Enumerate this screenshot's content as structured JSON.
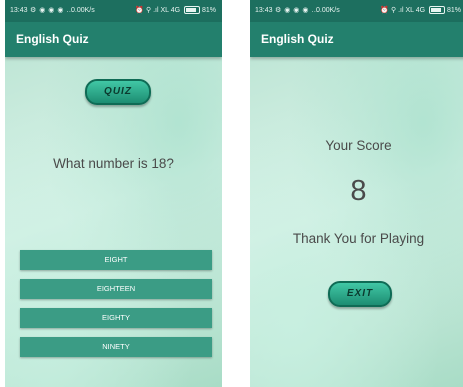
{
  "status_bar": {
    "time": "13:43",
    "icons": "⚙ ◉ ◉ ◉ …",
    "speed": "0.00K/s",
    "right": "⏰ ⚲ .ıl XL 4G",
    "battery": "81%"
  },
  "screens": {
    "question_screen": {
      "app_title": "English Quiz",
      "logo_text": "QUIZ",
      "question": "What number is 18?",
      "answers": [
        "EIGHT",
        "EIGHTEEN",
        "EIGHTY",
        "NINETY"
      ]
    },
    "score_screen": {
      "app_title": "English Quiz",
      "score_label": "Your Score",
      "score": "8",
      "thanks": "Thank You for Playing",
      "exit_label": "EXIT"
    }
  },
  "colors": {
    "status_bar": "#1d6f5f",
    "app_bar": "#23806d",
    "answer_button": "#3b9c85",
    "logo_gradient_top": "#41c7a5"
  }
}
